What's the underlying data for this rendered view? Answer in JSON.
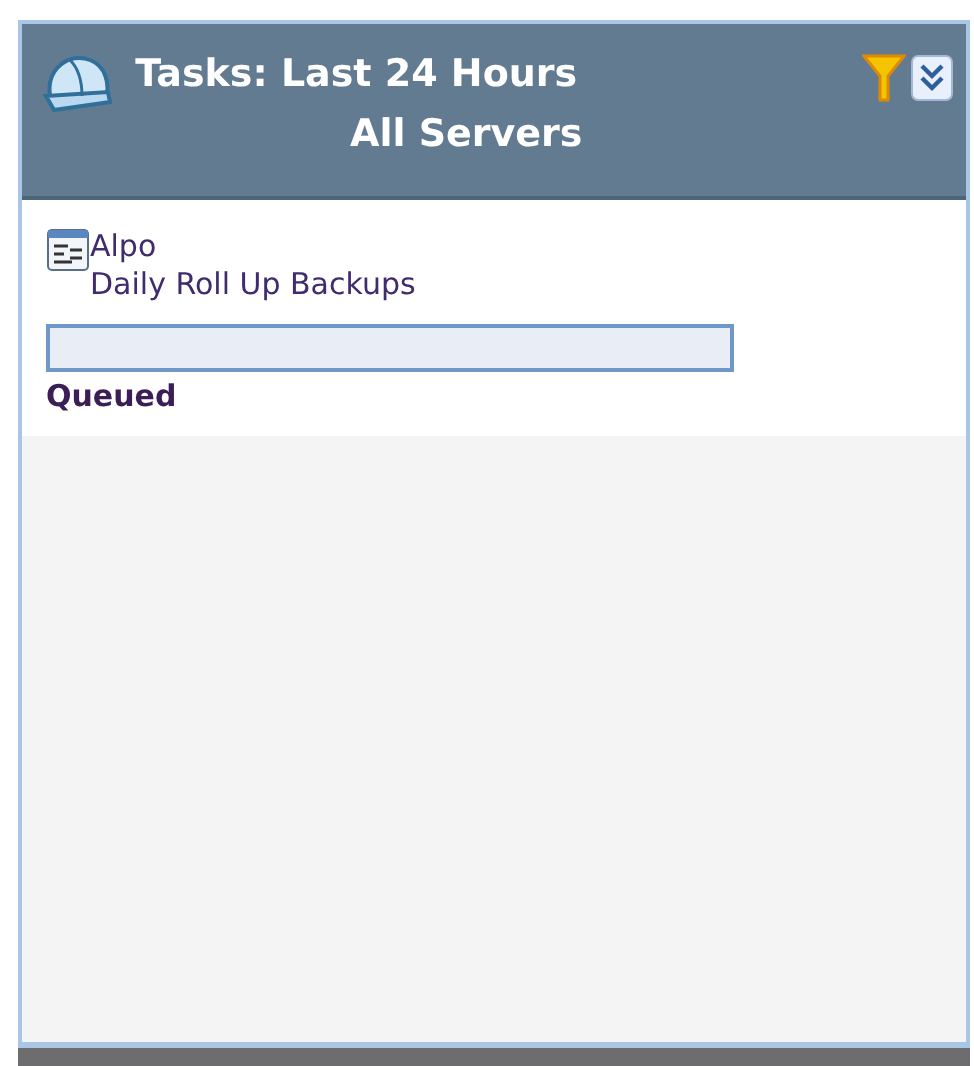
{
  "header": {
    "title": "Tasks: Last 24 Hours",
    "subtitle": "All Servers"
  },
  "tasks": [
    {
      "server": "Alpo",
      "name": "Daily Roll Up Backups",
      "level": 0,
      "status": "Queued"
    }
  ]
}
